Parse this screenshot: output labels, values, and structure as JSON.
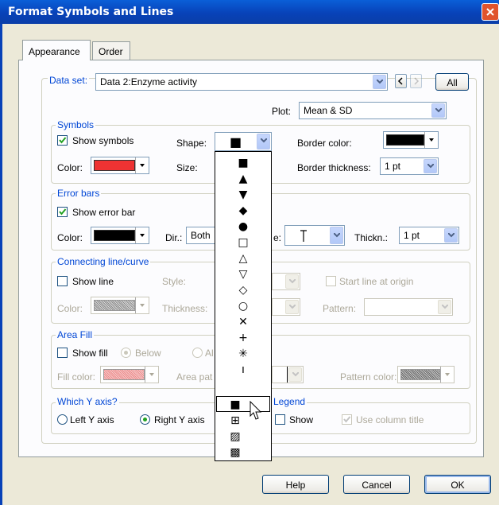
{
  "window": {
    "title": "Format Symbols and Lines"
  },
  "tabs": [
    {
      "label": "Appearance"
    },
    {
      "label": "Order"
    }
  ],
  "dataset": {
    "label": "Data set:",
    "value": "Data 2:Enzyme activity",
    "all_label": "All"
  },
  "plot": {
    "label": "Plot:",
    "value": "Mean & SD"
  },
  "symbols": {
    "title": "Symbols",
    "show_label": "Show symbols",
    "shape_label": "Shape:",
    "border_color_label": "Border color:",
    "color_label": "Color:",
    "size_label": "Size:",
    "border_thickness_label": "Border thickness:",
    "border_thickness_value": "1 pt",
    "color_hex": "#ee3333",
    "border_color_hex": "#000000"
  },
  "error_bars": {
    "title": "Error bars",
    "show_label": "Show error bar",
    "color_label": "Color:",
    "dir_label": "Dir.:",
    "dir_value": "Both",
    "style_label_tail": "e:",
    "thickness_label": "Thickn.:",
    "thickness_value": "1 pt",
    "color_hex": "#000000"
  },
  "connecting_line": {
    "title": "Connecting line/curve",
    "show_label": "Show line",
    "style_label": "Style:",
    "start_origin_label": "Start line at origin",
    "color_label": "Color:",
    "thickness_label": "Thickness:",
    "pattern_label": "Pattern:"
  },
  "area_fill": {
    "title": "Area Fill",
    "show_label": "Show fill",
    "below_label": "Below",
    "above_label_partial": "Al",
    "fill_color_label": "Fill color:",
    "area_pattern_label_partial": "Area pat",
    "pattern_color_label": "Pattern color:"
  },
  "which_y": {
    "title": "Which Y axis?",
    "left_label": "Left Y axis",
    "right_label": "Right Y axis"
  },
  "legend": {
    "title": "Legend",
    "show_label": "Show",
    "use_column_title_label": "Use column title"
  },
  "buttons": {
    "help": "Help",
    "cancel": "Cancel",
    "ok": "OK"
  },
  "shape_popup": {
    "items": [
      "■",
      "▲",
      "▼",
      "◆",
      "●",
      "□",
      "△",
      "▽",
      "◇",
      "○",
      "✕",
      "+",
      "✳",
      "ı",
      "■",
      "⊞",
      "▨",
      "▩"
    ],
    "selected_index": 14
  },
  "icons": {
    "close": "close-icon",
    "check": "check-icon",
    "dropdown": "chevron-down-icon",
    "prev": "chevron-left-icon",
    "next": "chevron-right-icon",
    "cursor": "mouse-pointer-icon",
    "error_bar_style": "error-bar-cap-icon"
  }
}
